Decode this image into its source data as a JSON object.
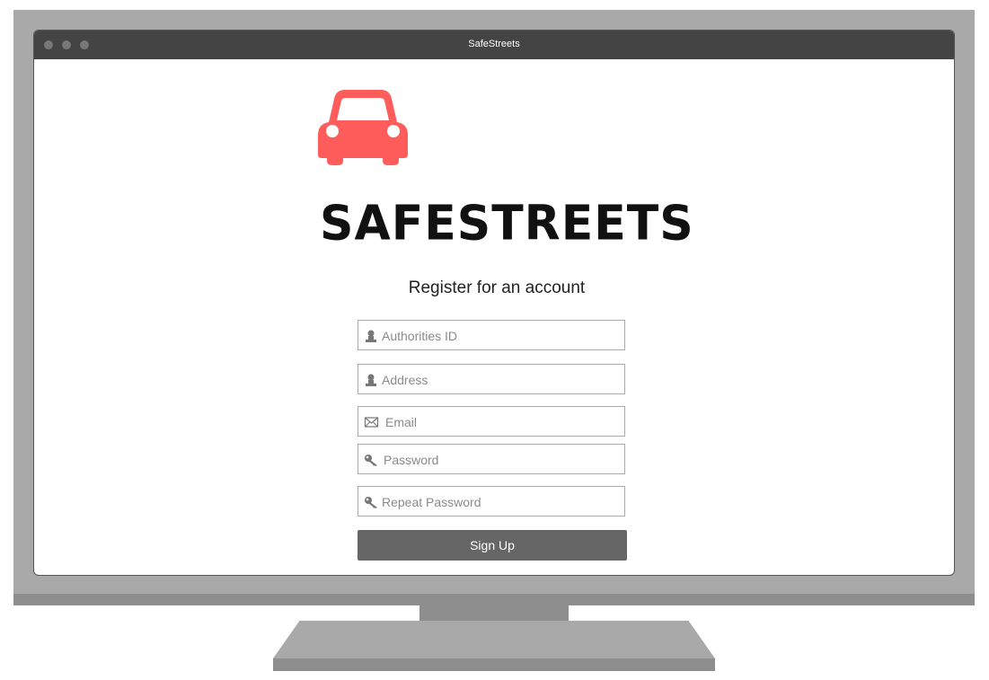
{
  "window": {
    "title": "SafeStreets"
  },
  "brand": {
    "name": "SAFESTREETS",
    "logo_icon": "car-icon",
    "logo_color": "#ff5c5c"
  },
  "form": {
    "heading": "Register for an account",
    "fields": {
      "authorities_id": {
        "placeholder": "Authorities ID",
        "value": "",
        "icon": "user-icon"
      },
      "address": {
        "placeholder": "Address",
        "value": "",
        "icon": "user-icon"
      },
      "email": {
        "placeholder": "Email",
        "value": "",
        "icon": "envelope-icon"
      },
      "password": {
        "placeholder": "Password",
        "value": "",
        "icon": "key-icon"
      },
      "repeat_password": {
        "placeholder": "Repeat Password",
        "value": "",
        "icon": "key-icon"
      }
    },
    "submit_label": "Sign Up",
    "submit_color": "#666666"
  }
}
